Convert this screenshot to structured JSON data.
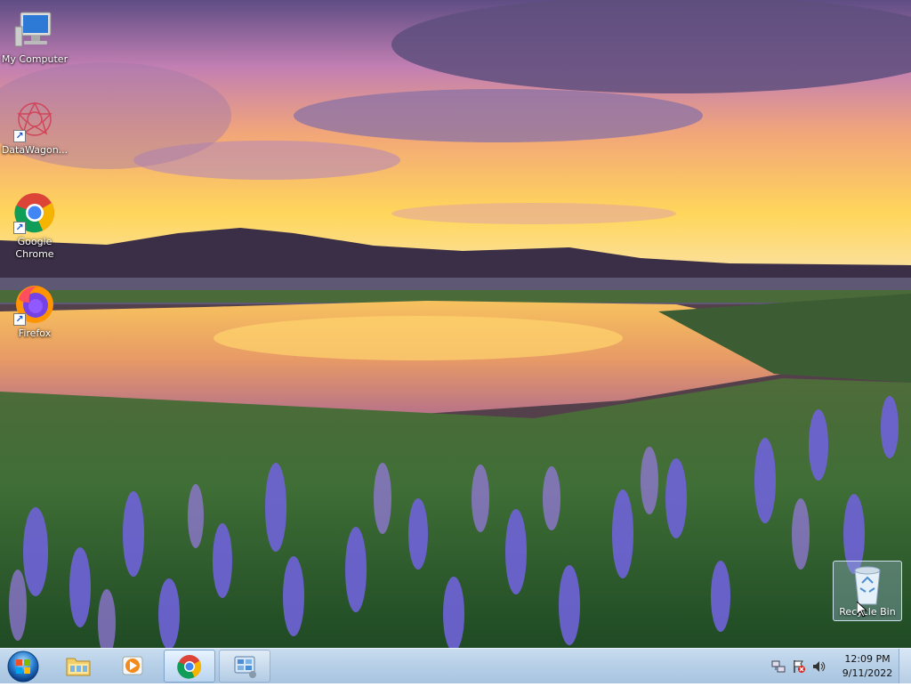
{
  "desktop": {
    "icons": [
      {
        "label": "My Computer",
        "icon": "computer-icon",
        "shortcut": false
      },
      {
        "label": "DataWagon...",
        "icon": "datawagon-icon",
        "shortcut": true
      },
      {
        "label": "Google Chrome",
        "icon": "chrome-icon",
        "shortcut": true
      },
      {
        "label": "Firefox",
        "icon": "firefox-icon",
        "shortcut": true
      }
    ],
    "recycle_bin": {
      "label": "Recycle Bin",
      "icon": "recycle-bin-icon"
    }
  },
  "taskbar": {
    "start": {
      "icon": "windows-start-icon"
    },
    "buttons": [
      {
        "name": "file-explorer",
        "icon": "folder-icon",
        "active": false
      },
      {
        "name": "media-player",
        "icon": "media-player-icon",
        "active": false
      },
      {
        "name": "google-chrome",
        "icon": "chrome-icon",
        "active": true
      },
      {
        "name": "control-panel",
        "icon": "control-panel-icon",
        "active": false
      }
    ],
    "tray": {
      "icons": [
        "network-icon",
        "action-center-icon",
        "volume-icon"
      ],
      "time": "12:09 PM",
      "date": "9/11/2022"
    }
  },
  "colors": {
    "taskbar_bg": "#b7d0e8",
    "chrome_red": "#db4437",
    "chrome_green": "#0f9d58",
    "chrome_yellow": "#f4b400",
    "chrome_blue": "#4285f4"
  }
}
